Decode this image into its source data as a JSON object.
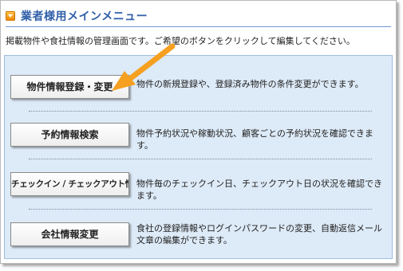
{
  "header": {
    "title": "業者様用メインメニュー"
  },
  "intro": "掲載物件や食社情報の管理画面です。ご希望のボタンをクリックして編集してください。",
  "menu": [
    {
      "button": "物件情報登録・変更",
      "description": "物件の新規登録や、登録済み物件の条件変更ができます。"
    },
    {
      "button": "予約情報検索",
      "description": "物件予約状況や稼動状況、顧客ごとの予約状況を確認できます。"
    },
    {
      "button": "チェックイン / チェックアウト情報",
      "description": "物件毎のチェックイン日、チェックアウト日の状況を確認できます。"
    },
    {
      "button": "会社情報変更",
      "description_line1": "食社の登録情報やログインパスワードの変更、自動返信メール",
      "description_line2": "文章の編集ができます。"
    }
  ],
  "colors": {
    "title": "#2f5fa8",
    "panel": "#ddeaf7",
    "arrow": "#f5a020"
  }
}
